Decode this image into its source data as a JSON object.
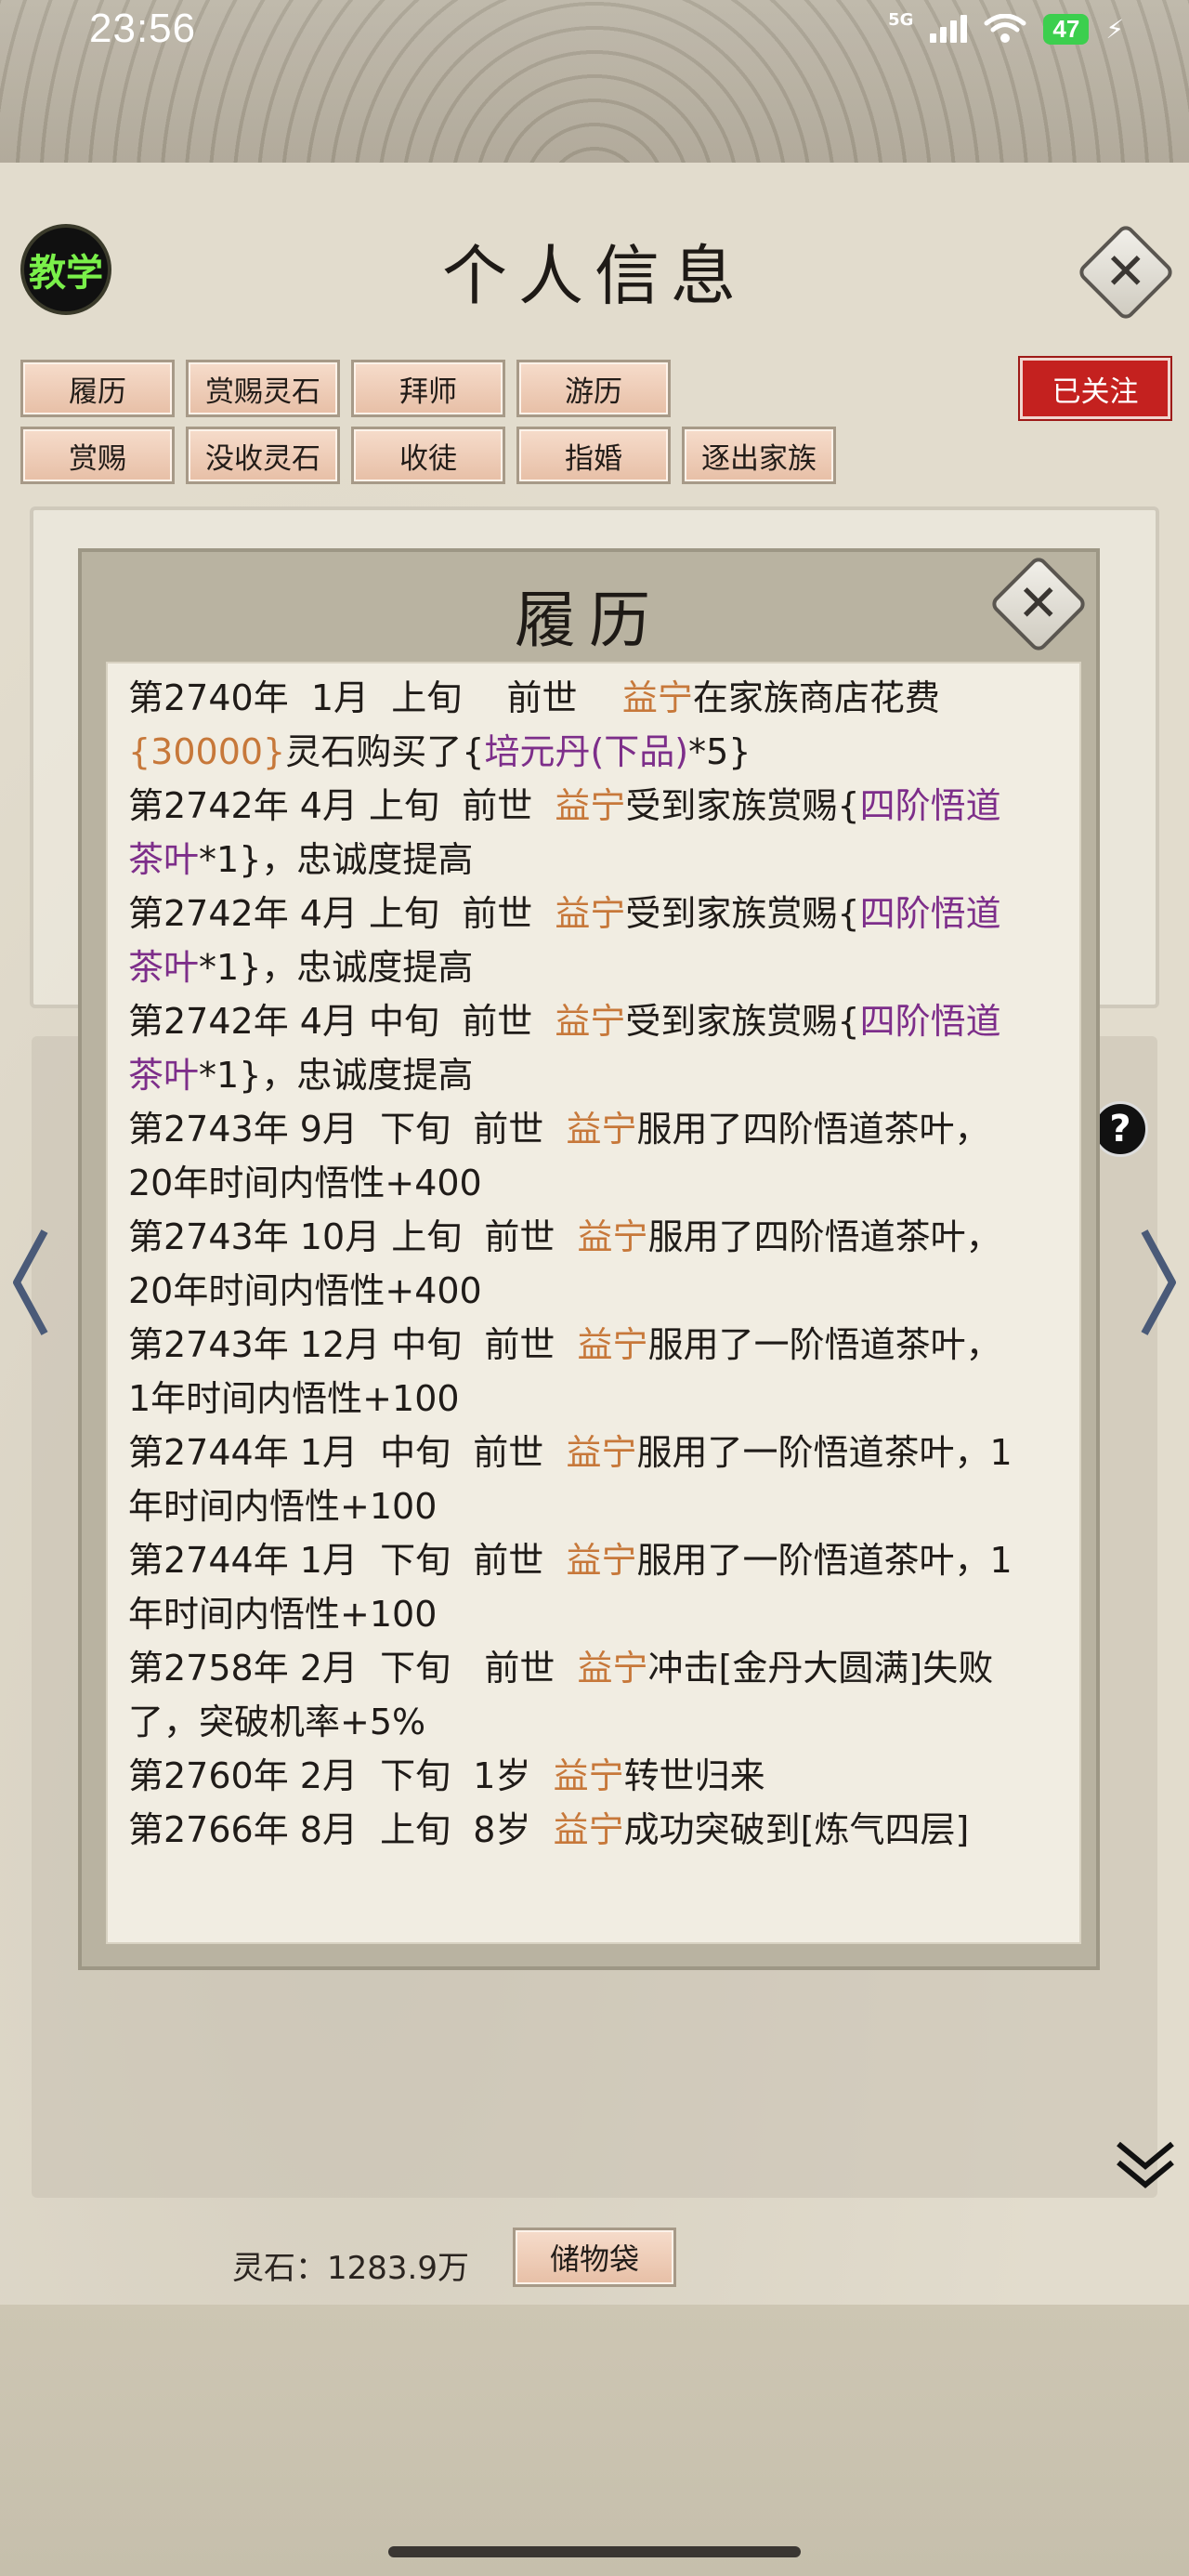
{
  "status_bar": {
    "time": "23:56",
    "network": "5G",
    "battery": "47"
  },
  "window": {
    "title": "个人信息",
    "tutorial_label": "教学",
    "followed_label": "已关注",
    "action_row1": [
      "履历",
      "赏赐灵石",
      "拜师",
      "游历"
    ],
    "action_row2": [
      "赏赐",
      "没收灵石",
      "收徒",
      "指婚",
      "逐出家族"
    ]
  },
  "history_popup": {
    "title": "履历",
    "entries": [
      {
        "prefix": "第2740年  1月  上旬    前世    ",
        "name": "益宁",
        "text": "在家族商店花费",
        "amount": "{30000}",
        "text2": "灵石购买了{",
        "item": "培元丹(下品)",
        "suffix": "*5}"
      },
      {
        "prefix": "第2742年 4月 上旬  前世  ",
        "name": "益宁",
        "text": "受到家族赏赐{",
        "item": "四阶悟道茶叶",
        "suffix": "*1}，忠诚度提高"
      },
      {
        "prefix": "第2742年 4月 上旬  前世  ",
        "name": "益宁",
        "text": "受到家族赏赐{",
        "item": "四阶悟道茶叶",
        "suffix": "*1}，忠诚度提高"
      },
      {
        "prefix": "第2742年 4月 中旬  前世  ",
        "name": "益宁",
        "text": "受到家族赏赐{",
        "item": "四阶悟道茶叶",
        "suffix": "*1}，忠诚度提高"
      },
      {
        "prefix": "第2743年 9月  下旬  前世  ",
        "name": "益宁",
        "text": "服用了四阶悟道茶叶，20年时间内悟性+400"
      },
      {
        "prefix": "第2743年 10月 上旬  前世  ",
        "name": "益宁",
        "text": "服用了四阶悟道茶叶，20年时间内悟性+400"
      },
      {
        "prefix": "第2743年 12月 中旬  前世  ",
        "name": "益宁",
        "text": "服用了一阶悟道茶叶，1年时间内悟性+100"
      },
      {
        "prefix": "第2744年 1月  中旬  前世  ",
        "name": "益宁",
        "text": "服用了一阶悟道茶叶，1年时间内悟性+100"
      },
      {
        "prefix": "第2744年 1月  下旬  前世  ",
        "name": "益宁",
        "text": "服用了一阶悟道茶叶，1年时间内悟性+100"
      },
      {
        "prefix": "第2758年 2月  下旬   前世  ",
        "name": "益宁",
        "text": "冲击[金丹大圆满]失败了，突破机率+5%"
      },
      {
        "prefix": "第2760年 2月  下旬  1岁  ",
        "name": "益宁",
        "text": "转世归来"
      },
      {
        "prefix": "第2766年 8月  上旬  8岁  ",
        "name": "益宁",
        "text": "成功突破到[炼气四层]"
      }
    ]
  },
  "footer": {
    "spirit_stone": "灵石：1283.9万",
    "storage_label": "储物袋"
  }
}
